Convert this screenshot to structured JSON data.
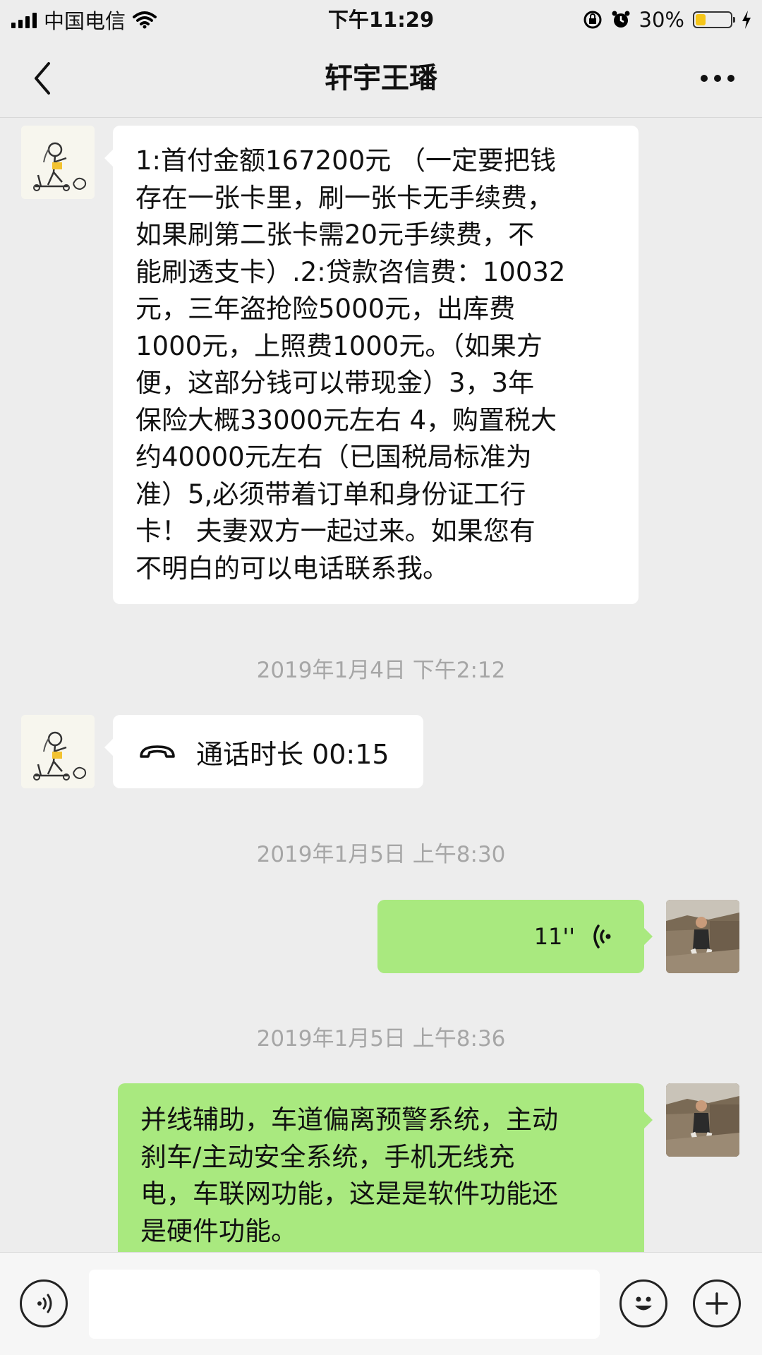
{
  "status_bar": {
    "carrier": "中国电信",
    "time": "下午11:29",
    "battery_percent_label": "30%",
    "battery_level": 0.3,
    "battery_color": "#F5C518"
  },
  "nav": {
    "title": "轩宇王璠",
    "back_icon": "chevron-left-icon",
    "more_icon": "more-icon"
  },
  "messages": [
    {
      "sender": "other",
      "type": "text",
      "text": "1:首付金额167200元 （一定要把钱\n存在一张卡里，刷一张卡无手续费，\n如果刷第二张卡需20元手续费，不\n能刷透支卡）.2:贷款咨信费：10032\n元，三年盗抢险5000元，出库费\n1000元，上照费1000元。（如果方\n便，这部分钱可以带现金）3，3年\n保险大概33000元左右 4，购置税大\n约40000元左右（已国税局标准为\n准）5,必须带着订单和身份证工行\n卡！ 夫妻双方一起过来。如果您有\n不明白的可以电话联系我。"
    },
    {
      "type": "timestamp",
      "text": "2019年1月4日 下午2:12"
    },
    {
      "sender": "other",
      "type": "call",
      "text": "通话时长 00:15",
      "icon": "phone-hangup-icon"
    },
    {
      "type": "timestamp",
      "text": "2019年1月5日 上午8:30"
    },
    {
      "sender": "self",
      "type": "voice",
      "duration": "11''",
      "icon": "voice-wave-icon"
    },
    {
      "type": "timestamp",
      "text": "2019年1月5日 上午8:36"
    },
    {
      "sender": "self",
      "type": "text",
      "text": "并线辅助，车道偏离预警系统，主动\n刹车/主动安全系统，手机无线充\n电，车联网功能，这是是软件功能还\n是硬件功能。"
    }
  ],
  "input_bar": {
    "voice_icon": "voice-input-icon",
    "emoji_icon": "emoji-icon",
    "plus_icon": "plus-icon",
    "placeholder": ""
  },
  "colors": {
    "background": "#EDEDED",
    "incoming_bubble": "#FFFFFF",
    "outgoing_bubble": "#A9E97F",
    "timestamp_text": "#A6A6A6"
  }
}
